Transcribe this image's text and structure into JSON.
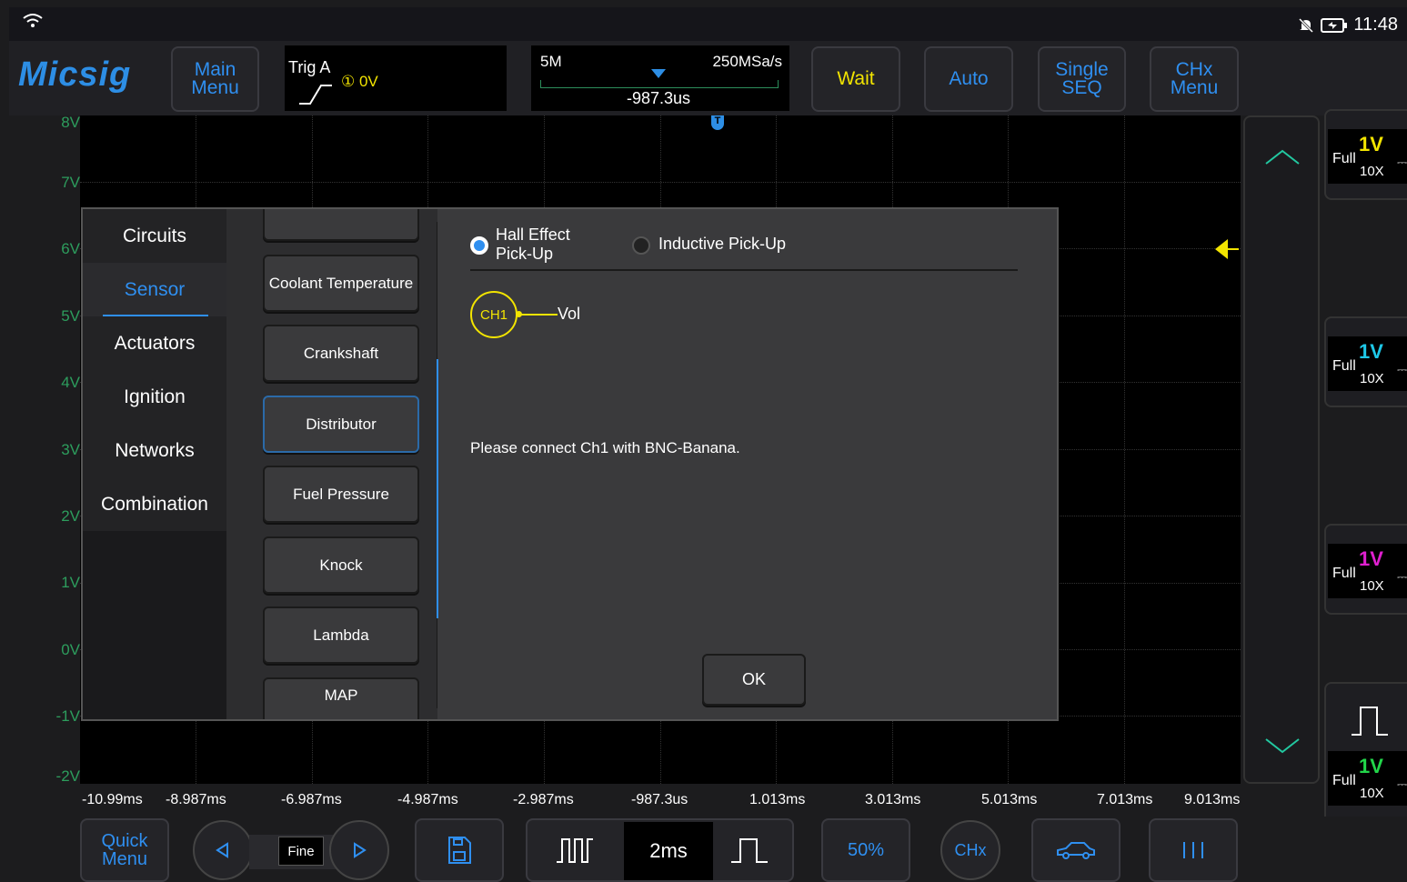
{
  "status": {
    "time": "11:48"
  },
  "app": {
    "logo": "Micsig"
  },
  "toolbar": {
    "main_menu": "Main Menu",
    "trig_source": "Trig A",
    "trig_level": "① 0V",
    "memory": "5M",
    "sample_rate": "250MSa/s",
    "h_position": "-987.3us",
    "wait": "Wait",
    "auto": "Auto",
    "single_seq": "Single SEQ",
    "chx_menu": "CHx Menu"
  },
  "y_axis": [
    "8V",
    "7V",
    "6V",
    "5V",
    "4V",
    "3V",
    "2V",
    "1V",
    "0V",
    "-1V",
    "-2V"
  ],
  "x_axis": [
    "-10.99ms",
    "-8.987ms",
    "-6.987ms",
    "-4.987ms",
    "-2.987ms",
    "-987.3us",
    "1.013ms",
    "3.013ms",
    "5.013ms",
    "7.013ms",
    "9.013ms"
  ],
  "trigger_marker": "T",
  "channels": [
    {
      "scale": "1V",
      "coupling": "Full",
      "probe": "10X",
      "color": "#f2e400"
    },
    {
      "scale": "1V",
      "coupling": "Full",
      "probe": "10X",
      "color": "#1ec8e8"
    },
    {
      "scale": "1V",
      "coupling": "Full",
      "probe": "10X",
      "color": "#e020d0"
    },
    {
      "scale": "1V",
      "coupling": "Full",
      "probe": "10X",
      "color": "#22d64a"
    }
  ],
  "dialog": {
    "categories": [
      "Circuits",
      "Sensor",
      "Actuators",
      "Ignition",
      "Networks",
      "Combination"
    ],
    "active_category": "Sensor",
    "items": [
      "Coolant Temperature",
      "Crankshaft",
      "Distributor",
      "Fuel Pressure",
      "Knock",
      "Lambda",
      "MAP"
    ],
    "selected_item": "Distributor",
    "options": {
      "hall": "Hall Effect Pick-Up",
      "inductive": "Inductive Pick-Up"
    },
    "ch_label": "CH1",
    "signal_label": "Vol",
    "message": "Please connect Ch1 with BNC-Banana.",
    "ok": "OK"
  },
  "bottom": {
    "quick_menu": "Quick Menu",
    "fine": "Fine",
    "timebase": "2ms",
    "fifty": "50%",
    "chx": "CHx"
  },
  "colors": {
    "accent": "#2f8ff0",
    "grid_label": "#2d9d5d",
    "ch1": "#f2e400"
  }
}
